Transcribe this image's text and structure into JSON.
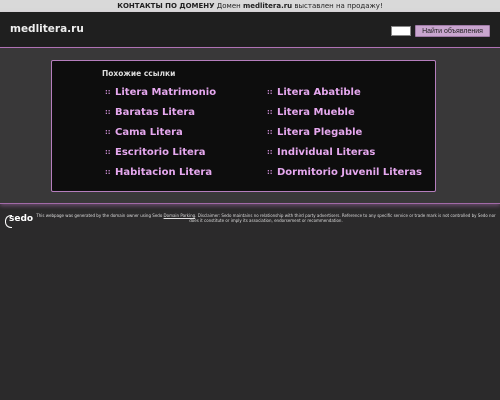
{
  "topbar": {
    "contact_label": "КОНТАКТЫ ПО ДОМЕНУ",
    "text_before": "Домен",
    "domain": "medlitera.ru",
    "text_after": "выставлен на продажу!"
  },
  "header": {
    "domain_title": "medlitera.ru",
    "search_value": "",
    "search_button": "Найти объявления"
  },
  "panel": {
    "title": "Похожие ссылки",
    "bullet": "::",
    "links_left": [
      "Litera Matrimonio",
      "Baratas Litera",
      "Cama Litera",
      "Escritorio Litera",
      "Habitacion Litera"
    ],
    "links_right": [
      "Litera Abatible",
      "Litera Mueble",
      "Litera Plegable",
      "Individual Literas",
      "Dormitorio Juvenil Literas"
    ]
  },
  "footer": {
    "logo_text": "sedo",
    "disclaimer_1": "This webpage was generated by the domain owner using Sedo",
    "disclaimer_link": "Domain Parking",
    "disclaimer_2": ". Disclaimer: Sedo maintains no relationship with third party advertisers. Reference to any specific service or trade mark is not controlled by Sedo nor does it constitute or imply its association, endorsement or recommendation."
  },
  "colors": {
    "accent": "#b57ebd",
    "link": "#e6a8ef",
    "background": "#2b2a2b"
  }
}
